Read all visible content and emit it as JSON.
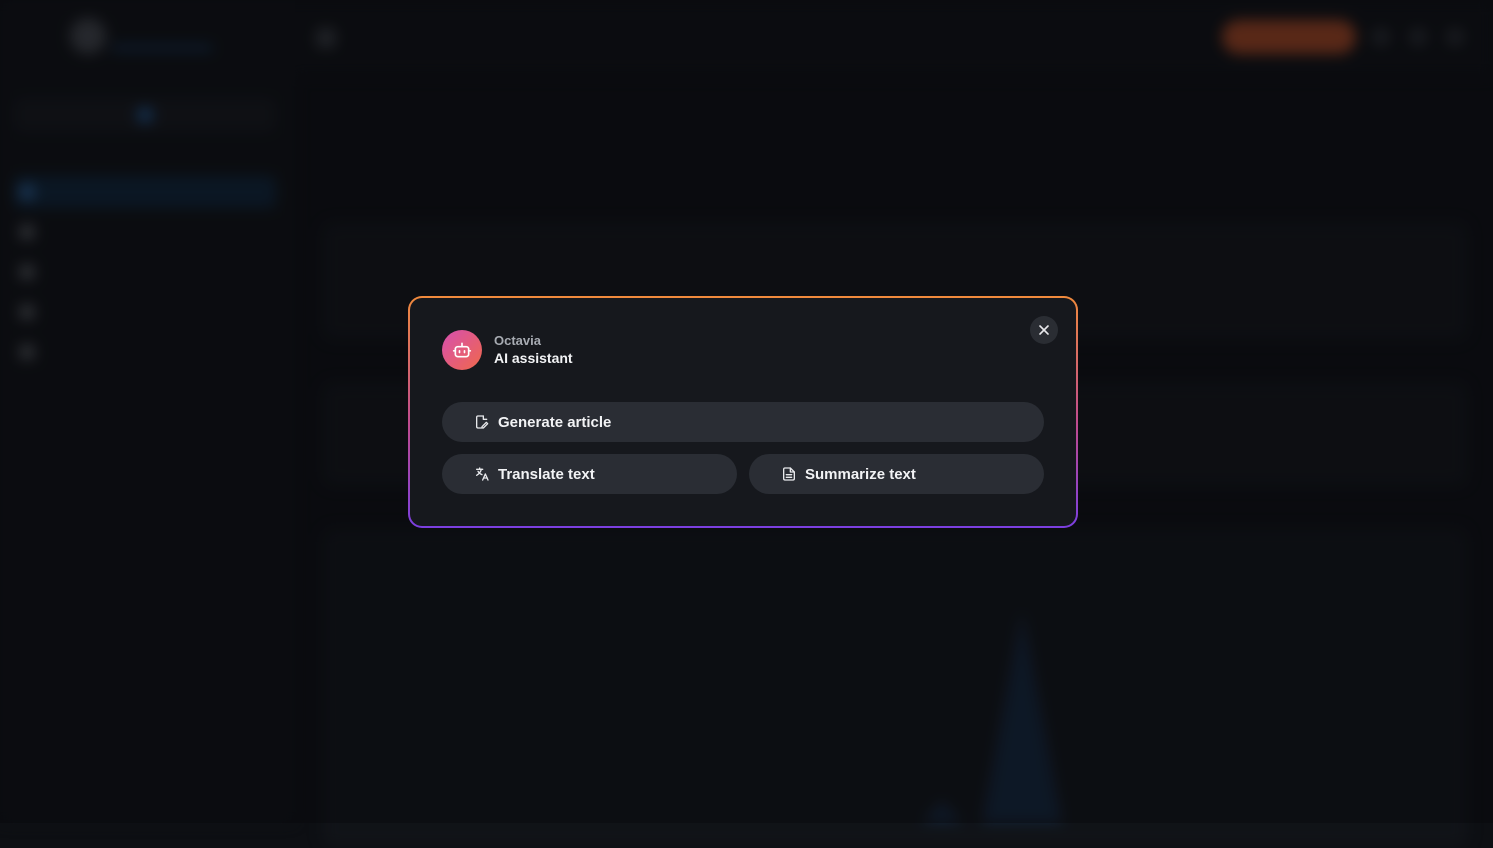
{
  "modal": {
    "bot_name": "Octavia",
    "bot_role": "AI assistant",
    "actions": {
      "generate": {
        "label": "Generate article",
        "icon": "edit-document-icon"
      },
      "translate": {
        "label": "Translate text",
        "icon": "translate-icon"
      },
      "summarize": {
        "label": "Summarize text",
        "icon": "document-text-icon"
      }
    },
    "close_icon": "close-icon",
    "avatar_icon": "robot-icon",
    "border_gradient": [
      "#f08a3c",
      "#c04b8f",
      "#7b3fe0"
    ]
  },
  "colors": {
    "accent_blue": "#4aa3ff",
    "upgrade_orange": "#e8602c",
    "avatar_gradient": [
      "#d64fb0",
      "#f0684a"
    ]
  }
}
